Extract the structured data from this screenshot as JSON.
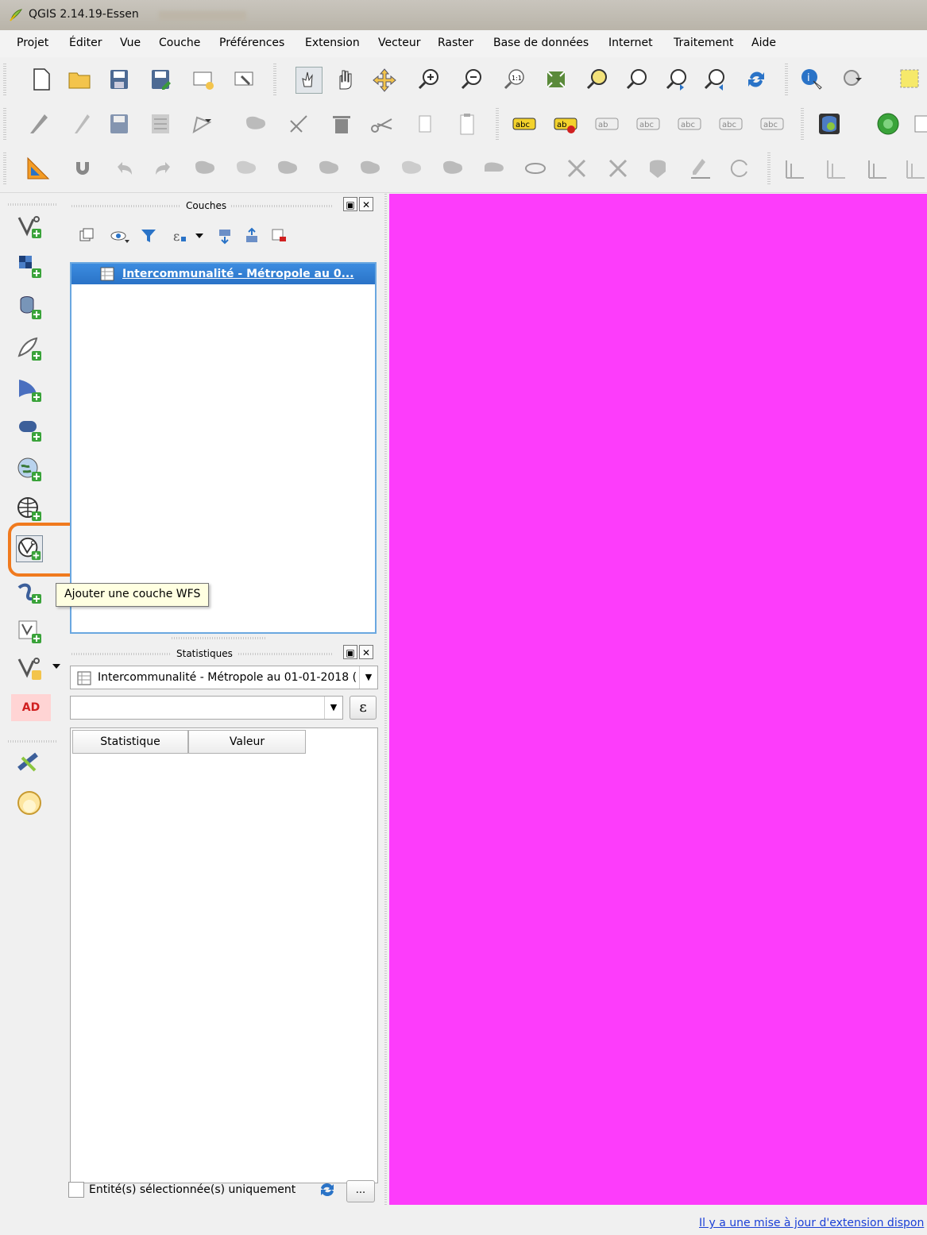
{
  "window": {
    "title": "QGIS 2.14.19-Essen"
  },
  "menubar": {
    "items": [
      "Projet",
      "Éditer",
      "Vue",
      "Couche",
      "Préférences",
      "Extension",
      "Vecteur",
      "Raster",
      "Base de données",
      "Internet",
      "Traitement",
      "Aide"
    ]
  },
  "layers_panel": {
    "title": "Couches",
    "layer_name": "Intercommunalité - Métropole au 0..."
  },
  "tooltip": {
    "text": "Ajouter une couche WFS"
  },
  "left_toolbar": {
    "ad_label": "AD"
  },
  "stats_panel": {
    "title": "Statistiques",
    "layer_select": "Intercommunalité - Métropole au 01-01-2018 (",
    "field_value": "",
    "expression_btn": "ε",
    "columns": [
      "Statistique",
      "Valeur"
    ],
    "selected_only_label": "Entité(s) sélectionnée(s) uniquement",
    "more_btn": "...",
    "selected_only_checked": false
  },
  "map": {
    "background": "#fd3cfb"
  },
  "status": {
    "update_link": "Il y a une mise à jour d'extension dispon"
  },
  "colors": {
    "highlight": "#f07a1e",
    "selection": "#2a73c7"
  }
}
